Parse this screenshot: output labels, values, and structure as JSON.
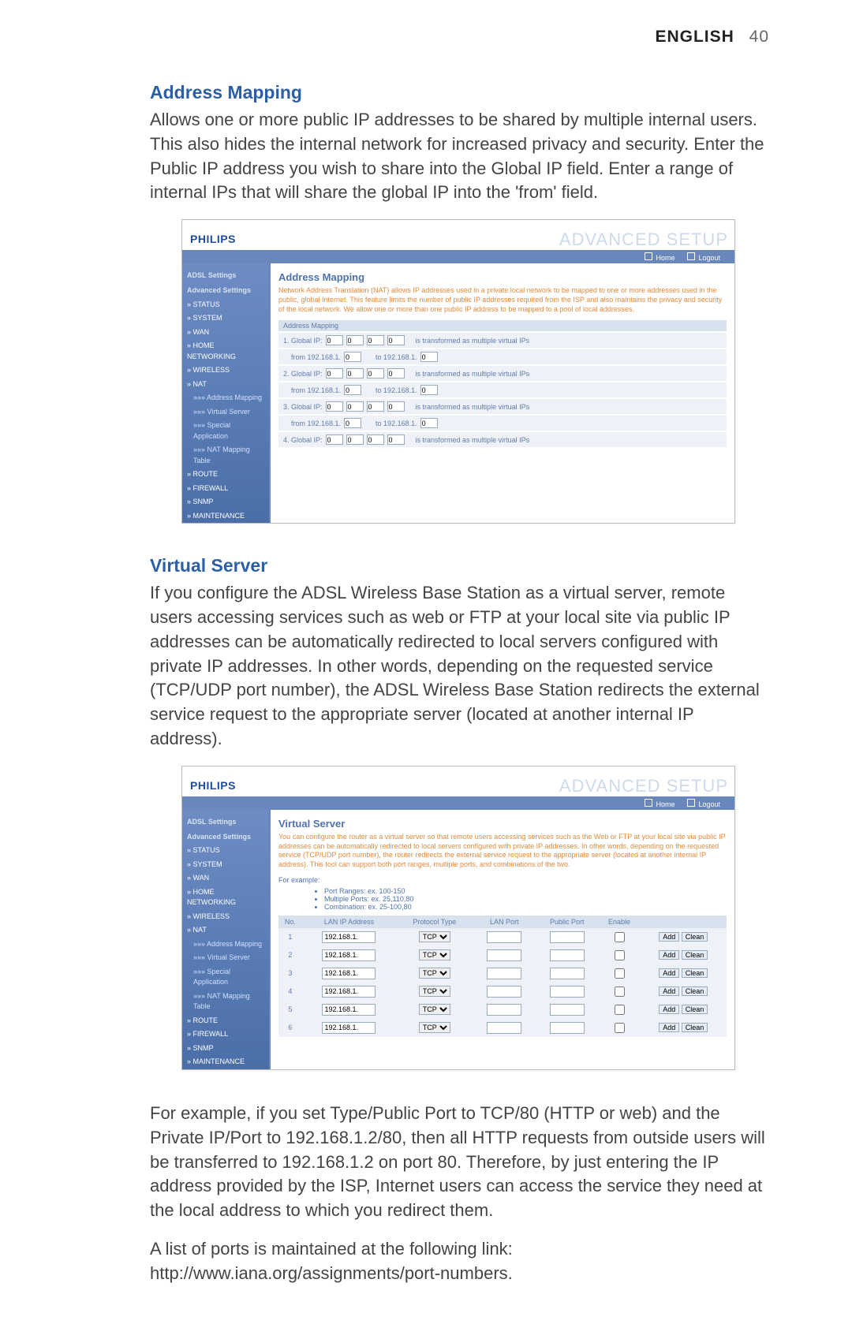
{
  "header": {
    "lang": "ENGLISH",
    "page": "40"
  },
  "s1": {
    "title": "Address Mapping",
    "para": "Allows one or more public IP addresses to be shared by multiple internal users. This also hides the internal network for increased privacy and security. Enter the Public IP address you wish to share into the Global IP field. Enter a range of internal IPs that will share the global IP into the 'from' field."
  },
  "shot1": {
    "brand": "PHILIPS",
    "adv": "ADVANCED SETUP",
    "home": "Home",
    "logout": "Logout",
    "panel_title": "Address Mapping",
    "desc": "Network Address Translation (NAT) allows IP addresses used in a private local network to be mapped to one or more addresses used in the public, global Internet. This feature limits the number of public IP addresses required from the ISP and also maintains the privacy and security of the local network. We allow one or more than one public IP address to be mapped to a pool of local addresses.",
    "group_hdr": "Address Mapping",
    "rows": [
      {
        "n": "1",
        "g": [
          "0",
          "0",
          "0",
          "0"
        ],
        "txt": "is transformed as multiple virtual IPs",
        "fa": "192.168.1.",
        "fb": "0",
        "ta": "192.168.1.",
        "tb": "0"
      },
      {
        "n": "2",
        "g": [
          "0",
          "0",
          "0",
          "0"
        ],
        "txt": "is transformed as multiple virtual IPs",
        "fa": "192.168.1.",
        "fb": "0",
        "ta": "192.168.1.",
        "tb": "0"
      },
      {
        "n": "3",
        "g": [
          "0",
          "0",
          "0",
          "0"
        ],
        "txt": "is transformed as multiple virtual IPs",
        "fa": "192.168.1.",
        "fb": "0",
        "ta": "192.168.1.",
        "tb": "0"
      },
      {
        "n": "4",
        "g": [
          "0",
          "0",
          "0",
          "0"
        ],
        "txt": "is transformed as multiple virtual IPs"
      }
    ],
    "label_global": "Global IP:",
    "label_from": "from",
    "label_to": "to"
  },
  "sidebar": {
    "hd1": "ADSL Settings",
    "hd2": "Advanced Settings",
    "items": [
      "» STATUS",
      "» SYSTEM",
      "» WAN",
      "» HOME NETWORKING",
      "» WIRELESS",
      "» NAT",
      "»»» Address Mapping",
      "»»» Virtual Server",
      "»»» Special Application",
      "»»» NAT Mapping Table",
      "» ROUTE",
      "» FIREWALL",
      "» SNMP",
      "» MAINTENANCE"
    ]
  },
  "s2": {
    "title": "Virtual Server",
    "para": "If you configure the ADSL Wireless Base Station as a virtual server, remote users accessing services such as web or FTP at your local site via public IP addresses can be automatically redirected to local servers configured with private IP addresses. In other words, depending on the requested service (TCP/UDP port number), the ADSL Wireless Base Station redirects the external service request to the appropriate server (located at another internal IP address)."
  },
  "shot2": {
    "panel_title": "Virtual Server",
    "desc": "You can configure the router as a virtual server so that remote users accessing services such as the Web or FTP at your local site via public IP addresses can be automatically redirected to local servers configured with private IP addresses. In other words, depending on the requested service (TCP/UDP port number), the router redirects the external service request to the appropriate server (located at another internal IP address). This tool can support both port ranges, multiple ports, and combinations of the two.",
    "example_label": "For example:",
    "bullets": [
      "Port Ranges: ex. 100-150",
      "Multiple Ports: ex. 25,110,80",
      "Combination: ex. 25-100,80"
    ],
    "th": [
      "No.",
      "LAN IP Address",
      "Protocol Type",
      "LAN Port",
      "Public Port",
      "Enable",
      ""
    ],
    "rows": [
      {
        "n": "1",
        "ip": "192.168.1."
      },
      {
        "n": "2",
        "ip": "192.168.1."
      },
      {
        "n": "3",
        "ip": "192.168.1."
      },
      {
        "n": "4",
        "ip": "192.168.1."
      },
      {
        "n": "5",
        "ip": "192.168.1."
      },
      {
        "n": "6",
        "ip": "192.168.1."
      }
    ],
    "proto": "TCP",
    "btn_add": "Add",
    "btn_clean": "Clean"
  },
  "s3": {
    "p1": "For example, if you set Type/Public Port to TCP/80 (HTTP or web) and the Private IP/Port to 192.168.1.2/80, then all HTTP requests from outside users will be transferred to 192.168.1.2 on port 80. Therefore, by just entering the IP address provided by the ISP, Internet users can access the service they need at the local address to which you redirect them.",
    "p2": "A list of ports is maintained at the following link: http://www.iana.org/assignments/port-numbers."
  }
}
